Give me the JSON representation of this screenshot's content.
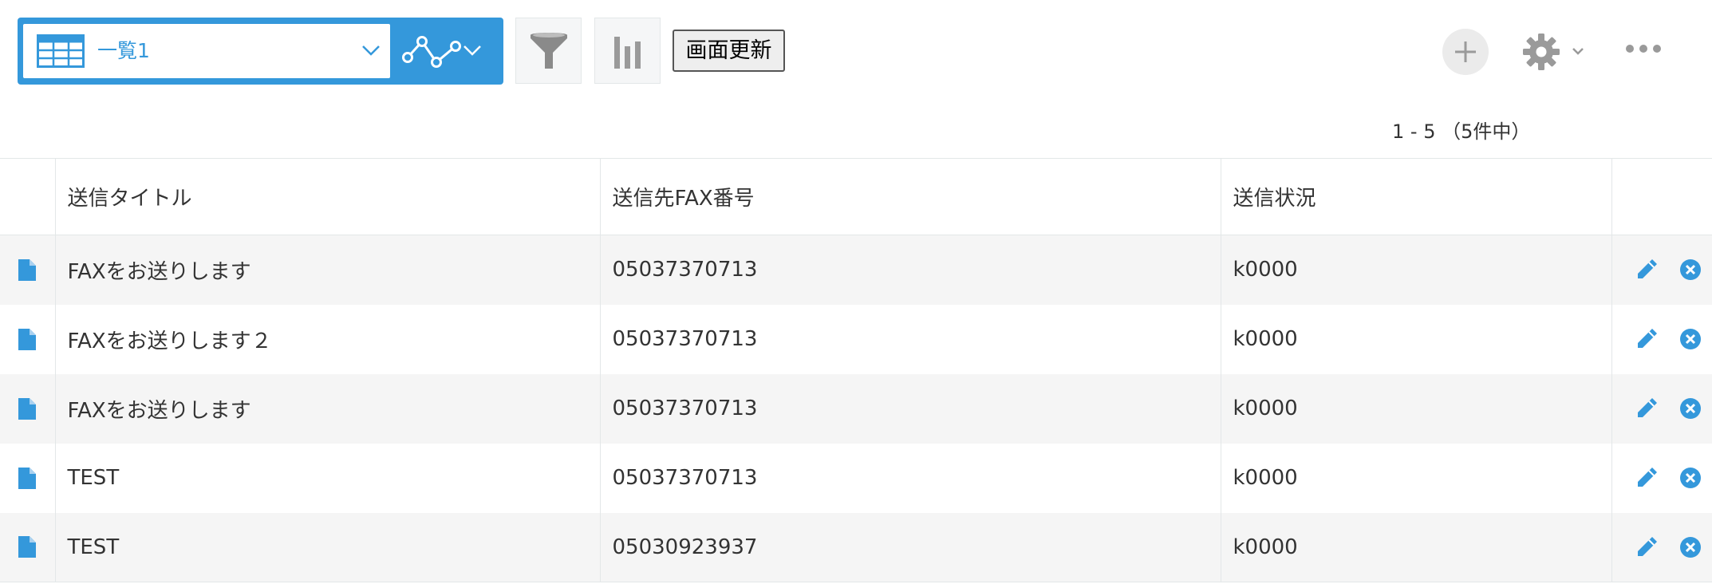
{
  "toolbar": {
    "view_name": "一覧1",
    "refresh_label": "画面更新"
  },
  "pager": {
    "text": "1 - 5 （5件中）"
  },
  "table": {
    "columns": [
      "送信タイトル",
      "送信先FAX番号",
      "送信状況"
    ],
    "rows": [
      [
        "FAXをお送りします",
        "05037370713",
        "k0000"
      ],
      [
        "FAXをお送りします２",
        "05037370713",
        "k0000"
      ],
      [
        "FAXをお送りします",
        "05037370713",
        "k0000"
      ],
      [
        "TEST",
        "05037370713",
        "k0000"
      ],
      [
        "TEST",
        "05030923937",
        "k0000"
      ]
    ]
  },
  "colors": {
    "accent": "#3498db",
    "row_alt": "#f5f5f5",
    "icon_gray": "#9a9a9a"
  }
}
